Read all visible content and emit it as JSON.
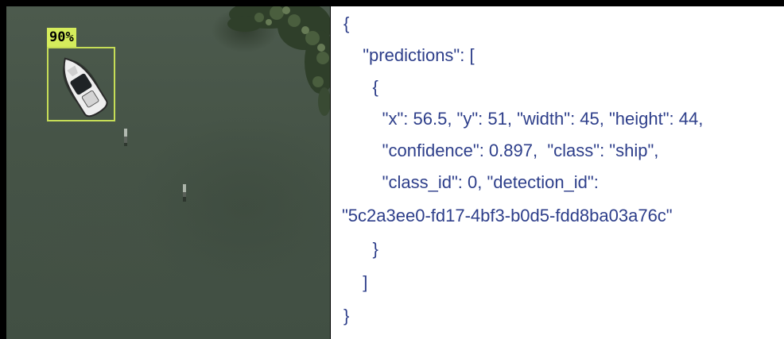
{
  "detection": {
    "confidence_label": "90%",
    "class_icon": "ship-icon",
    "box_color": "#c6dd57",
    "label_color": "#d5ec5c"
  },
  "json_text": {
    "color": "#2d3e8a",
    "lines": [
      "{",
      "  \"predictions\": [",
      "    {",
      "      \"x\": 56.5, \"y\": 51, \"width\": 45, \"height\": 44,",
      "      \"confidence\": 0.897,  \"class\": \"ship\",",
      "      \"class_id\": 0, \"detection_id\":",
      "\"5c2a3ee0-fd17-4bf3-b0d5-fdd8ba03a76c\"",
      "    }",
      "  ]",
      "}"
    ]
  }
}
